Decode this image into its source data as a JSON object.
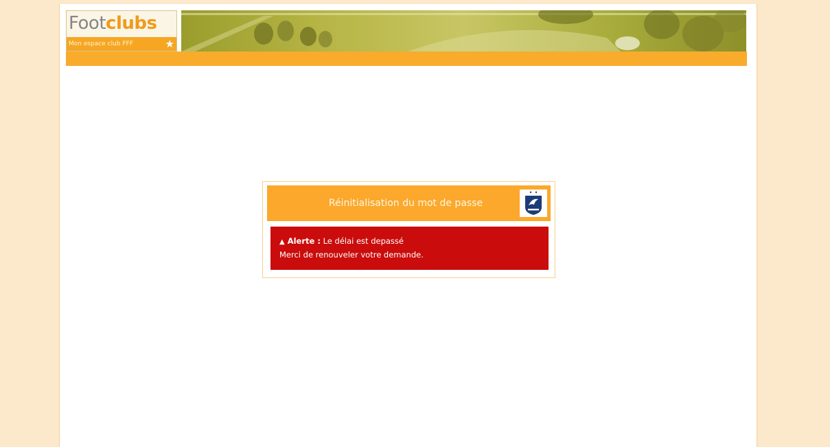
{
  "header": {
    "logo_foot": "Foot",
    "logo_clubs": "clubs",
    "logo_tagline": "Mon espace club FFF"
  },
  "dialog": {
    "title": "Réinitialisation du mot de passe",
    "federation_logo_icon": "fff-shield-icon"
  },
  "alert": {
    "icon": "warning-triangle-icon",
    "label": "Alerte :",
    "message": "Le délai est depassé",
    "instruction": "Merci de renouveler votre demande."
  },
  "colors": {
    "page_background": "#fce8cb",
    "accent_orange": "#f9ab2c",
    "alert_red": "#cb0c0c"
  }
}
